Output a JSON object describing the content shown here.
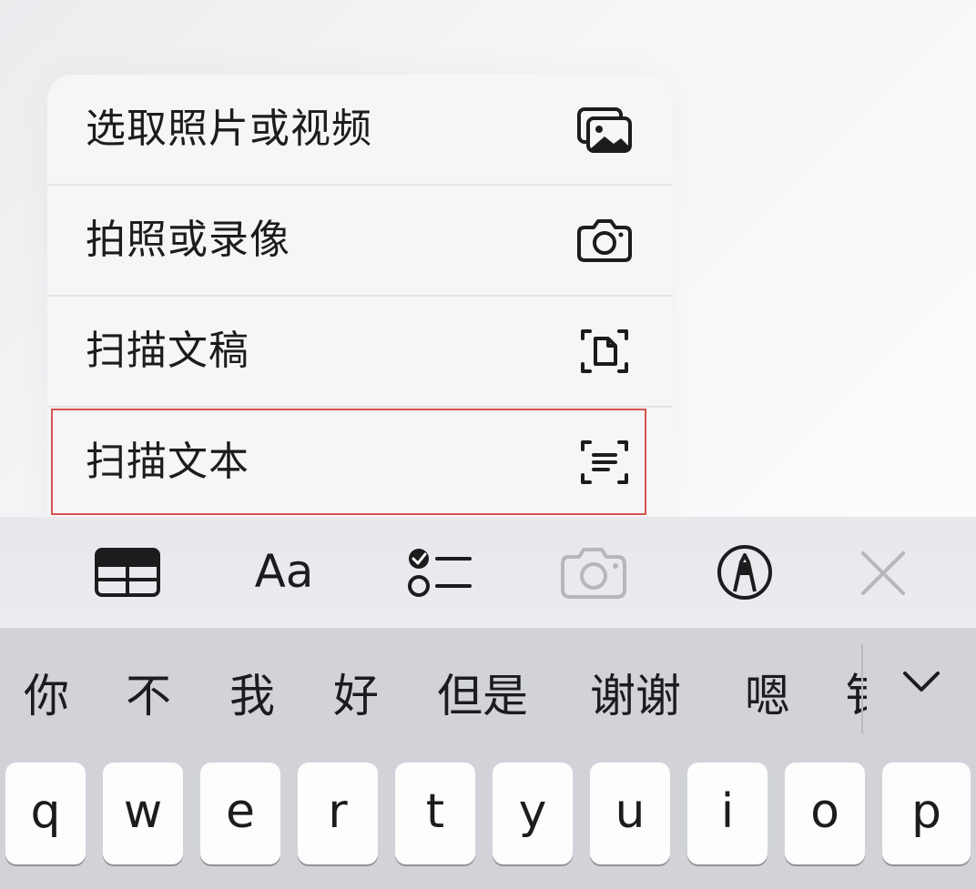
{
  "menu": {
    "items": [
      {
        "label": "选取照片或视频",
        "icon": "photo-library-icon"
      },
      {
        "label": "拍照或录像",
        "icon": "camera-icon"
      },
      {
        "label": "扫描文稿",
        "icon": "scan-document-icon"
      },
      {
        "label": "扫描文本",
        "icon": "scan-text-icon",
        "highlighted": true
      }
    ]
  },
  "toolbar": {
    "format_label": "Aa",
    "tools": [
      "table-icon",
      "text-format-icon",
      "checklist-icon",
      "camera-icon",
      "markup-pen-icon",
      "close-icon"
    ]
  },
  "keyboard": {
    "candidates": [
      "你",
      "不",
      "我",
      "好",
      "但是",
      "谢谢",
      "嗯",
      "钅"
    ],
    "keys": [
      "q",
      "w",
      "e",
      "r",
      "t",
      "y",
      "u",
      "i",
      "o",
      "p"
    ]
  },
  "colors": {
    "highlight": "#d9534f",
    "keyboard_bg": "#d1d3d9",
    "key_bg": "#fdfdfd",
    "menu_bg": "#f6f6f7",
    "disabled_icon": "#b6b6bb"
  }
}
